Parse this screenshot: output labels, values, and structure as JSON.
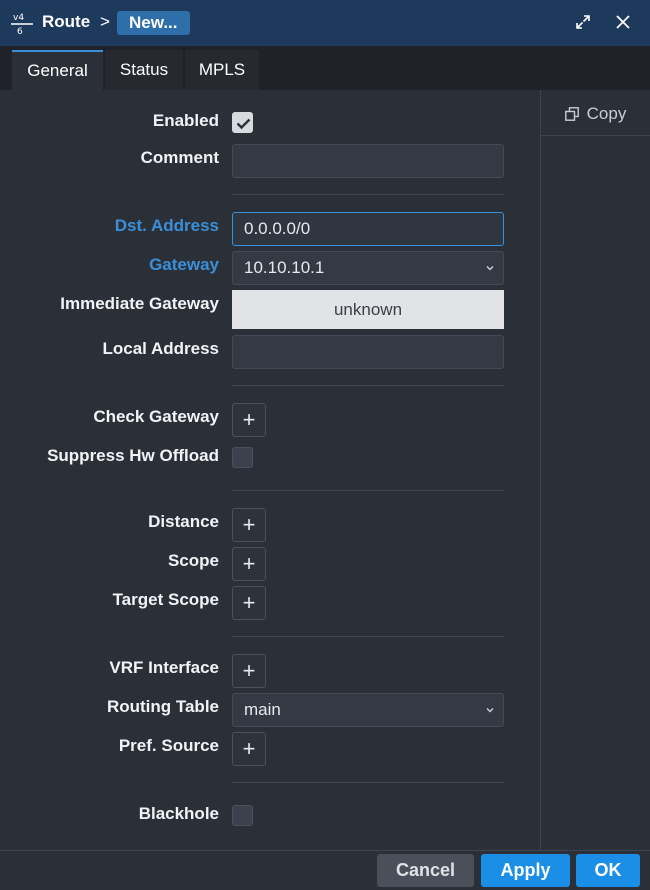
{
  "window": {
    "title": "Route",
    "separator": ">",
    "badge": "New...",
    "icons": {
      "app": "route-v4-v6-icon",
      "maximize": "maximize-icon",
      "close": "close-icon"
    }
  },
  "tabs": [
    {
      "label": "General",
      "active": true
    },
    {
      "label": "Status",
      "active": false
    },
    {
      "label": "MPLS",
      "active": false
    }
  ],
  "side": {
    "copy_label": "Copy",
    "copy_icon": "copy-icon"
  },
  "form": {
    "enabled": {
      "label": "Enabled",
      "checked": true
    },
    "comment": {
      "label": "Comment",
      "value": ""
    },
    "dst_address": {
      "label": "Dst. Address",
      "value": "0.0.0.0/0"
    },
    "gateway": {
      "label": "Gateway",
      "value": "10.10.10.1"
    },
    "immediate_gateway": {
      "label": "Immediate Gateway",
      "value": "unknown"
    },
    "local_address": {
      "label": "Local Address",
      "value": ""
    },
    "check_gateway": {
      "label": "Check Gateway",
      "add": "+"
    },
    "suppress_hw_offload": {
      "label": "Suppress Hw Offload",
      "checked": false
    },
    "distance": {
      "label": "Distance",
      "add": "+"
    },
    "scope": {
      "label": "Scope",
      "add": "+"
    },
    "target_scope": {
      "label": "Target Scope",
      "add": "+"
    },
    "vrf_interface": {
      "label": "VRF Interface",
      "add": "+"
    },
    "routing_table": {
      "label": "Routing Table",
      "value": "main"
    },
    "pref_source": {
      "label": "Pref. Source",
      "add": "+"
    },
    "blackhole": {
      "label": "Blackhole",
      "checked": false
    }
  },
  "footer": {
    "cancel": "Cancel",
    "apply": "Apply",
    "ok": "OK"
  },
  "colors": {
    "accent": "#1b8ee8",
    "label_highlight": "#3b8fd8",
    "titlebar": "#1d3a5c",
    "background": "#2b3038"
  }
}
